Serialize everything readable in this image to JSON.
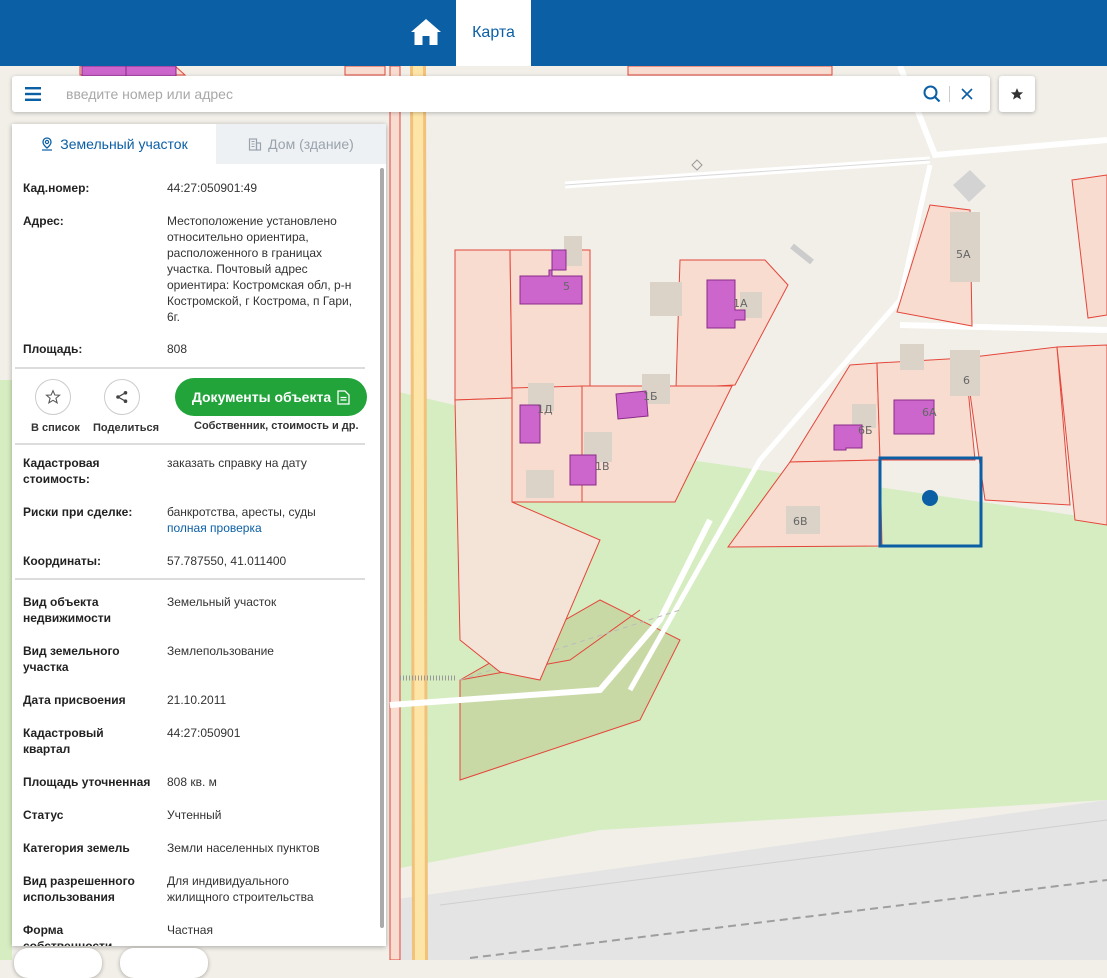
{
  "header": {
    "home_icon": "home-icon",
    "map_tab_label": "Карта",
    "brand_color": "#0b5fa5"
  },
  "search": {
    "placeholder": "введите номер или адрес",
    "menu_icon": "hamburger-icon",
    "search_icon": "search-icon",
    "clear_icon": "close-icon",
    "favorite_icon": "star-icon"
  },
  "panel": {
    "tabs": [
      {
        "label": "Земельный участок",
        "icon": "map-pin-icon",
        "active": true
      },
      {
        "label": "Дом (здание)",
        "icon": "building-icon",
        "active": false
      }
    ],
    "top_rows": [
      {
        "key": "Кад.номер:",
        "value": "44:27:050901:49",
        "link": true
      },
      {
        "key": "Адрес:",
        "value": "Местоположение установлено относительно ориентира, расположенного в границах участка. Почтовый адрес ориентира: Костромская обл, р-н Костромской, г Кострома, п Гари, 6г.",
        "link": false
      },
      {
        "key": "Площадь:",
        "value": "808",
        "link": false
      }
    ],
    "actions": {
      "add_to_list_label": "В список",
      "share_label": "Поделиться",
      "documents_button": "Документы объекта",
      "documents_sub": "Собственник, стоимость и др.",
      "documents_color": "#22a43b"
    },
    "mid_rows": {
      "cadastral_value_key": "Кадастровая стоимость:",
      "cadastral_value_link": "заказать справку на дату",
      "risks_key": "Риски при сделке:",
      "risks_text": "банкротства, аресты, суды",
      "risks_link": "полная проверка",
      "coords_key": "Координаты:",
      "coords_value": "57.787550, 41.011400"
    },
    "details": [
      {
        "key": "Вид объекта недвижимости",
        "value": "Земельный участок"
      },
      {
        "key": "Вид земельного участка",
        "value": "Землепользование"
      },
      {
        "key": "Дата присвоения",
        "value": "21.10.2011"
      },
      {
        "key": "Кадастровый квартал",
        "value": "44:27:050901"
      },
      {
        "key": "Площадь уточненная",
        "value": "808 кв. м"
      },
      {
        "key": "Статус",
        "value": "Учтенный"
      },
      {
        "key": "Категория земель",
        "value": "Земли населенных пунктов"
      },
      {
        "key": "Вид разрешенного использования",
        "value": "Для индивидуального жилищного строительства"
      },
      {
        "key": "Форма собственности",
        "value": "Частная"
      }
    ]
  },
  "map": {
    "parcel_labels": [
      "5",
      "1А",
      "5А",
      "6",
      "1Д",
      "1Б",
      "6Б",
      "6А",
      "1В",
      "6В"
    ],
    "selected_parcel_color": "#0b5fa5",
    "parcel_border_color": "#e4463a",
    "building_color": "#cc66cc"
  }
}
